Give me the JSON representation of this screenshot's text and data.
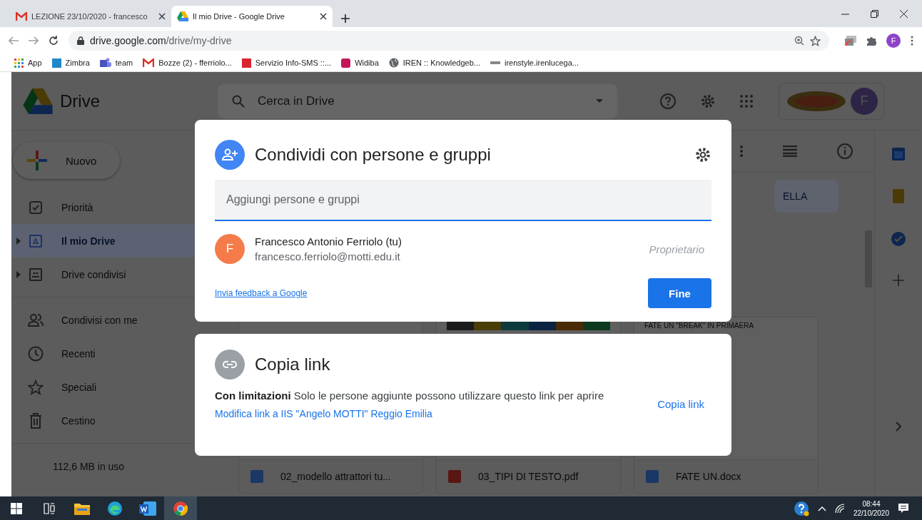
{
  "browser": {
    "tabs": [
      {
        "title": "LEZIONE 23/10/2020 - francesco",
        "kind": "gmail",
        "selected": false
      },
      {
        "title": "Il mio Drive - Google Drive",
        "kind": "drive",
        "selected": true
      }
    ],
    "address": {
      "host": "drive.google.com",
      "path": "/drive/my-drive"
    },
    "profile_letter": "F",
    "bookmarks": [
      {
        "label": "App",
        "kind": "apps"
      },
      {
        "label": "Zimbra",
        "kind": "zimbra"
      },
      {
        "label": "team",
        "kind": "teams"
      },
      {
        "label": "Bozze (2) - fferriolo...",
        "kind": "gmail"
      },
      {
        "label": "Servizio Info-SMS ::...",
        "kind": "red"
      },
      {
        "label": "Widiba",
        "kind": "widiba"
      },
      {
        "label": "IREN :: Knowledgeb...",
        "kind": "globe"
      },
      {
        "label": "irenstyle.irenlucega...",
        "kind": "iren"
      }
    ]
  },
  "drive": {
    "logo_text": "Drive",
    "search_placeholder": "Cerca in Drive",
    "account_letter": "F",
    "new_button": "Nuovo",
    "nav": [
      {
        "label": "Priorità",
        "expandable": false,
        "selected": false
      },
      {
        "label": "Il mio Drive",
        "expandable": true,
        "selected": true
      },
      {
        "label": "Drive condivisi",
        "expandable": true,
        "selected": false
      },
      {
        "label": "Condivisi con me",
        "expandable": false,
        "selected": false
      },
      {
        "label": "Recenti",
        "expandable": false,
        "selected": false
      },
      {
        "label": "Speciali",
        "expandable": false,
        "selected": false
      },
      {
        "label": "Cestino",
        "expandable": false,
        "selected": false
      }
    ],
    "storage": "112,6 MB in uso",
    "chip": "ELLA",
    "preview_heading": "FATE UN \"BREAK\" IN PRIMAERA",
    "files": [
      {
        "name": "02_modello attrattori tu...",
        "kind": "word"
      },
      {
        "name": "03_TIPI DI TESTO.pdf",
        "kind": "pdf"
      },
      {
        "name": "FATE UN.docx",
        "kind": "word"
      }
    ]
  },
  "share_dialog": {
    "title": "Condividi con persone e gruppi",
    "placeholder": "Aggiungi persone e gruppi",
    "people": [
      {
        "initial": "F",
        "name": "Francesco Antonio Ferriolo (tu)",
        "email": "francesco.ferriolo@motti.edu.it",
        "role": "Proprietario"
      }
    ],
    "feedback_link": "Invia feedback a Google",
    "done_button": "Fine"
  },
  "link_dialog": {
    "title": "Copia link",
    "description": "**Con limitazioni** Solo le persone aggiunte possono utilizzare questo link per aprire",
    "change_link": "Modifica link a IIS \"Angelo MOTTI\" Reggio Emilia",
    "copy_button": "Copia link"
  },
  "taskbar": {
    "apps": [
      {
        "kind": "taskview",
        "selected": false
      },
      {
        "kind": "explorer",
        "selected": false
      },
      {
        "kind": "edge",
        "selected": false
      },
      {
        "kind": "word",
        "selected": false
      },
      {
        "kind": "chrome",
        "selected": true
      }
    ],
    "time": "08:44",
    "date": "22/10/2020"
  }
}
